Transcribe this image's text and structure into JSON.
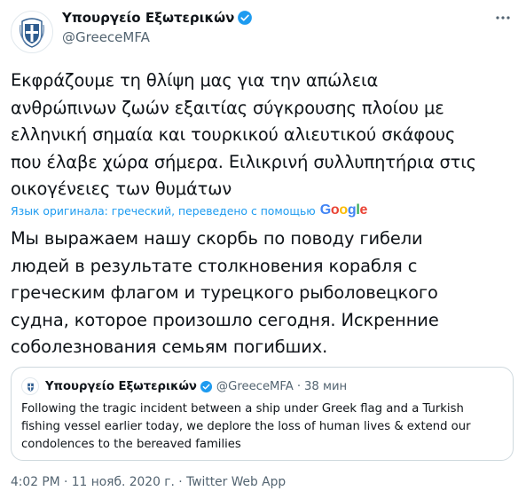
{
  "account": {
    "name": "Υπουργείο Εξωτερικών",
    "handle": "@GreeceMFA"
  },
  "tweet": {
    "original_text": "Εκφράζουμε τη θλίψη μας για την απώλεια\nανθρώπινων ζωών εξαιτίας σύγκρουσης πλοίου με\nελληνική σημαία και τουρκικού αλιευτικού σκάφους\nπου έλαβε χώρα σήμερα. Ειλικρινή συλλυπητήρια στις\nοικογένειες των θυμάτων",
    "translation_note": "Язык оригинала: греческий, переведено с помощью",
    "translation_provider": "Google",
    "translated_text": "Мы выражаем нашу скорбь по поводу гибели\nлюдей в результате столкновения корабля с\nгреческим флагом и турецкого рыболовецкого\nсудна, которое произошло сегодня. Искренние\nсоболезнования семьям погибших."
  },
  "quote": {
    "name": "Υπουργείο Εξωτερικών",
    "handle": "@GreeceMFA",
    "separator": "·",
    "time": "38 мин",
    "text": "Following the tragic incident between a ship under Greek flag and a Turkish\nfishing vessel earlier today, we deplore the loss of human lives & extend our\ncondolences to the bereaved families"
  },
  "footer": {
    "time": "4:02 PM",
    "separator": "·",
    "date": "11 нояб. 2020 г.",
    "source": "Twitter Web App"
  },
  "colors": {
    "accent": "#1d9bf0",
    "secondary_text": "#536471",
    "border": "#cfd9de",
    "crest_blue": "#2f5d8f"
  }
}
